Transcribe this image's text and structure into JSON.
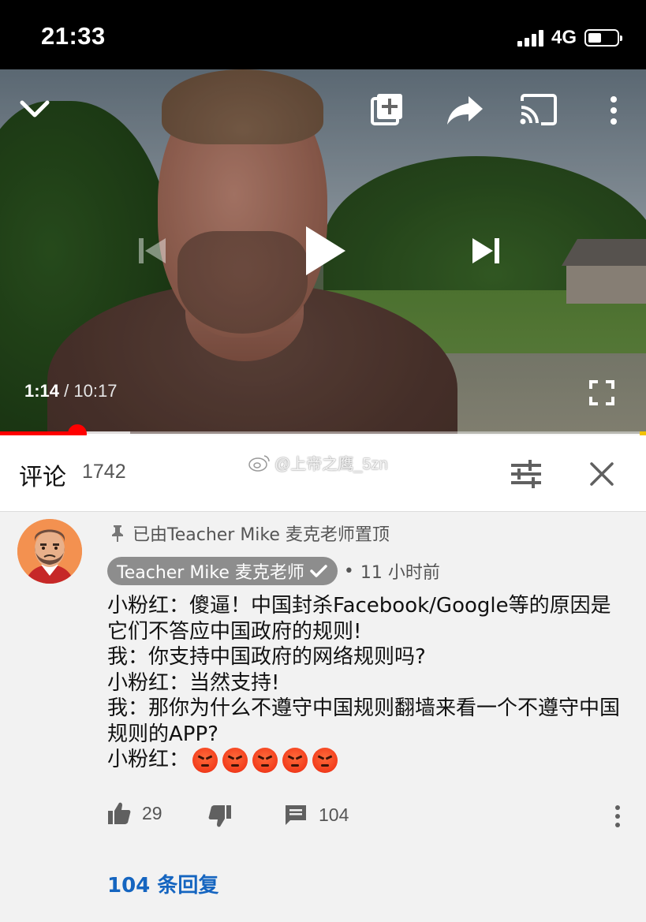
{
  "status_bar": {
    "time": "21:33",
    "network": "4G",
    "signal_bars": 4,
    "battery_level": 0.45
  },
  "video": {
    "current_time": "1:14",
    "duration": "/ 10:17",
    "progress_fraction": 0.12,
    "controls": [
      "chevron-down-icon",
      "add-to-playlist-icon",
      "share-icon",
      "cast-icon",
      "more-vert-icon",
      "skip-previous-icon",
      "play-icon",
      "skip-next-icon",
      "fullscreen-icon"
    ]
  },
  "comments": {
    "title": "评论",
    "count": "1742",
    "watermark": "@上帝之鹰_5zn",
    "colors": {
      "progress": "#ff0000",
      "link": "#1565c0"
    }
  },
  "comment": {
    "pinned_text": "已由Teacher Mike 麦克老师置顶",
    "author": "Teacher Mike 麦克老师",
    "separator": "•",
    "time_ago": "11 小时前",
    "lines": [
      "小粉红：傻逼！中国封杀Facebook/Google等的原因是它们不答应中国政府的规则!",
      "我：你支持中国政府的网络规则吗?",
      "小粉红：当然支持!",
      "我：那你为什么不遵守中国规则翻墙来看一个不遵守中国规则的APP?"
    ],
    "last_line_prefix": "小粉红：",
    "emoji_count": 5,
    "emoji": "angry-face",
    "likes": "29",
    "replies_count": "104",
    "replies_link": "104 条回复"
  }
}
